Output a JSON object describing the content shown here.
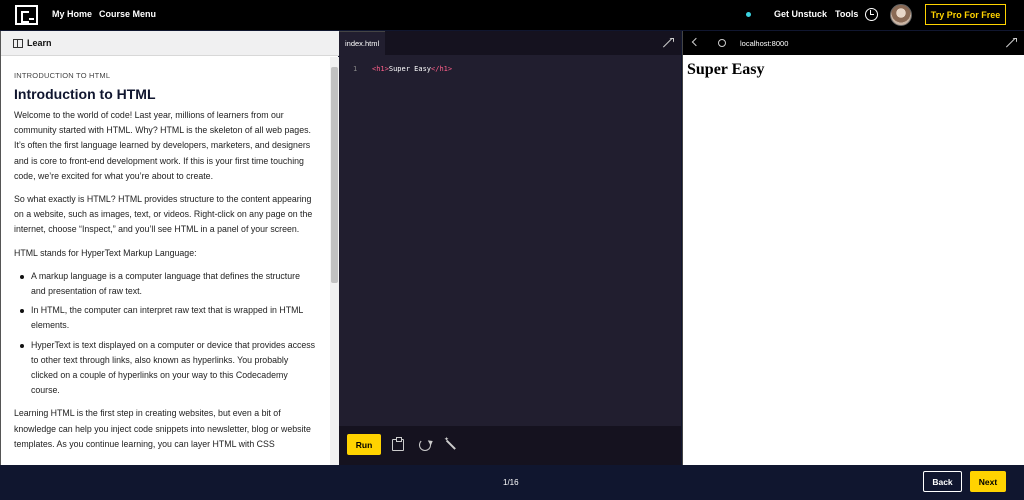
{
  "nav": {
    "my_home": "My Home",
    "course_menu": "Course Menu",
    "get_unstuck": "Get Unstuck",
    "tools": "Tools",
    "try_pro": "Try Pro For Free"
  },
  "learn": {
    "header_label": "Learn",
    "eyebrow": "INTRODUCTION TO HTML",
    "title": "Introduction to HTML",
    "paragraphs": [
      "Welcome to the world of code! Last year, millions of learners from our community started with HTML. Why? HTML is the skeleton of all web pages. It’s often the first language learned by developers, marketers, and designers and is core to front-end development work. If this is your first time touching code, we’re excited for what you’re about to create.",
      "So what exactly is HTML? HTML provides structure to the content appearing on a website, such as images, text, or videos. Right-click on any page on the internet, choose “Inspect,” and you’ll see HTML in a panel of your screen.",
      "HTML stands for HyperText Markup Language:",
      "Learning HTML is the first step in creating websites, but even a bit of knowledge can help you inject code snippets into newsletter, blog or website templates. As you continue learning, you can layer HTML with CSS"
    ],
    "bullets": [
      "A markup language is a computer language that defines the structure and presentation of raw text.",
      "In HTML, the computer can interpret raw text that is wrapped in HTML elements.",
      "HyperText is text displayed on a computer or device that provides access to other text through links, also known as hyperlinks. You probably clicked on a couple of hyperlinks on your way to this Codecademy course."
    ]
  },
  "editor": {
    "tab_name": "index.html",
    "line_number": "1",
    "code": {
      "open_tag": "<h1>",
      "text": "Super Easy",
      "close_tag": "</h1>"
    },
    "run_label": "Run"
  },
  "browser": {
    "url": "localhost:8000",
    "heading": "Super Easy"
  },
  "footer": {
    "page_counter": "1/16",
    "back_label": "Back",
    "next_label": "Next"
  }
}
